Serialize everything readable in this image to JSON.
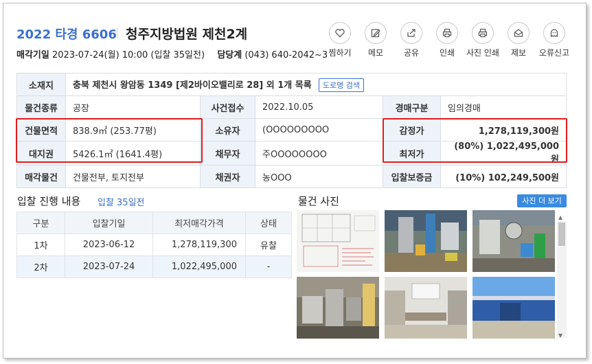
{
  "header": {
    "case_number": "2022 타경 6606",
    "court": "청주지방법원 제천2계",
    "sale_date_label": "매각기일",
    "sale_date_value": "2023-07-24(월) 10:00 (입찰 35일전)",
    "dept_label": "담당계",
    "dept_value": "(043) 640-2042~3"
  },
  "actions": [
    {
      "label": "찜하기",
      "icon": "heart-icon"
    },
    {
      "label": "메모",
      "icon": "pencil-icon"
    },
    {
      "label": "공유",
      "icon": "share-icon"
    },
    {
      "label": "인쇄",
      "icon": "printer-icon"
    },
    {
      "label": "사진 인쇄",
      "icon": "printer-icon"
    },
    {
      "label": "제보",
      "icon": "envelope-icon"
    },
    {
      "label": "오류신고",
      "icon": "ghost-icon"
    }
  ],
  "info": {
    "location_label": "소재지",
    "location_value": "충북 제천시 왕암동 1349 [제2바이오밸리로 28] 외 1개 목록",
    "road_search": "도로명 검색",
    "type_label": "물건종류",
    "type_value": "공장",
    "filed_label": "사건접수",
    "filed_value": "2022.10.05",
    "auction_type_label": "경매구분",
    "auction_type_value": "임의경매",
    "building_label": "건물면적",
    "building_value": "838.9㎡ (253.77평)",
    "owner_label": "소유자",
    "owner_value": "(OOOOOOOOO",
    "appraisal_label": "감정가",
    "appraisal_value": "1,278,119,300원",
    "land_label": "대지권",
    "land_value": "5426.1㎡ (1641.4평)",
    "debtor_label": "채무자",
    "debtor_value": "주OOOOOOOO",
    "min_price_label": "최저가",
    "min_price_value": "(80%) 1,022,495,000원",
    "sale_item_label": "매각물건",
    "sale_item_value": "건물전부, 토지전부",
    "creditor_label": "채권자",
    "creditor_value": "농OOO",
    "deposit_label": "입찰보증금",
    "deposit_value": "(10%) 102,249,500원"
  },
  "bids": {
    "title": "입찰 진행 내용",
    "subtitle": "입찰 35일전",
    "headers": [
      "구분",
      "입찰기일",
      "최저매각가격",
      "상태"
    ],
    "rows": [
      [
        "1차",
        "2023-06-12",
        "1,278,119,300",
        "유찰"
      ],
      [
        "2차",
        "2023-07-24",
        "1,022,495,000",
        "-"
      ]
    ]
  },
  "photos": {
    "title": "물건 사진",
    "more_button": "사진 더 보기"
  },
  "colors": {
    "accent": "#3a6fcf",
    "highlight": "#e01c1c",
    "header_cell": "#eef3f9"
  }
}
